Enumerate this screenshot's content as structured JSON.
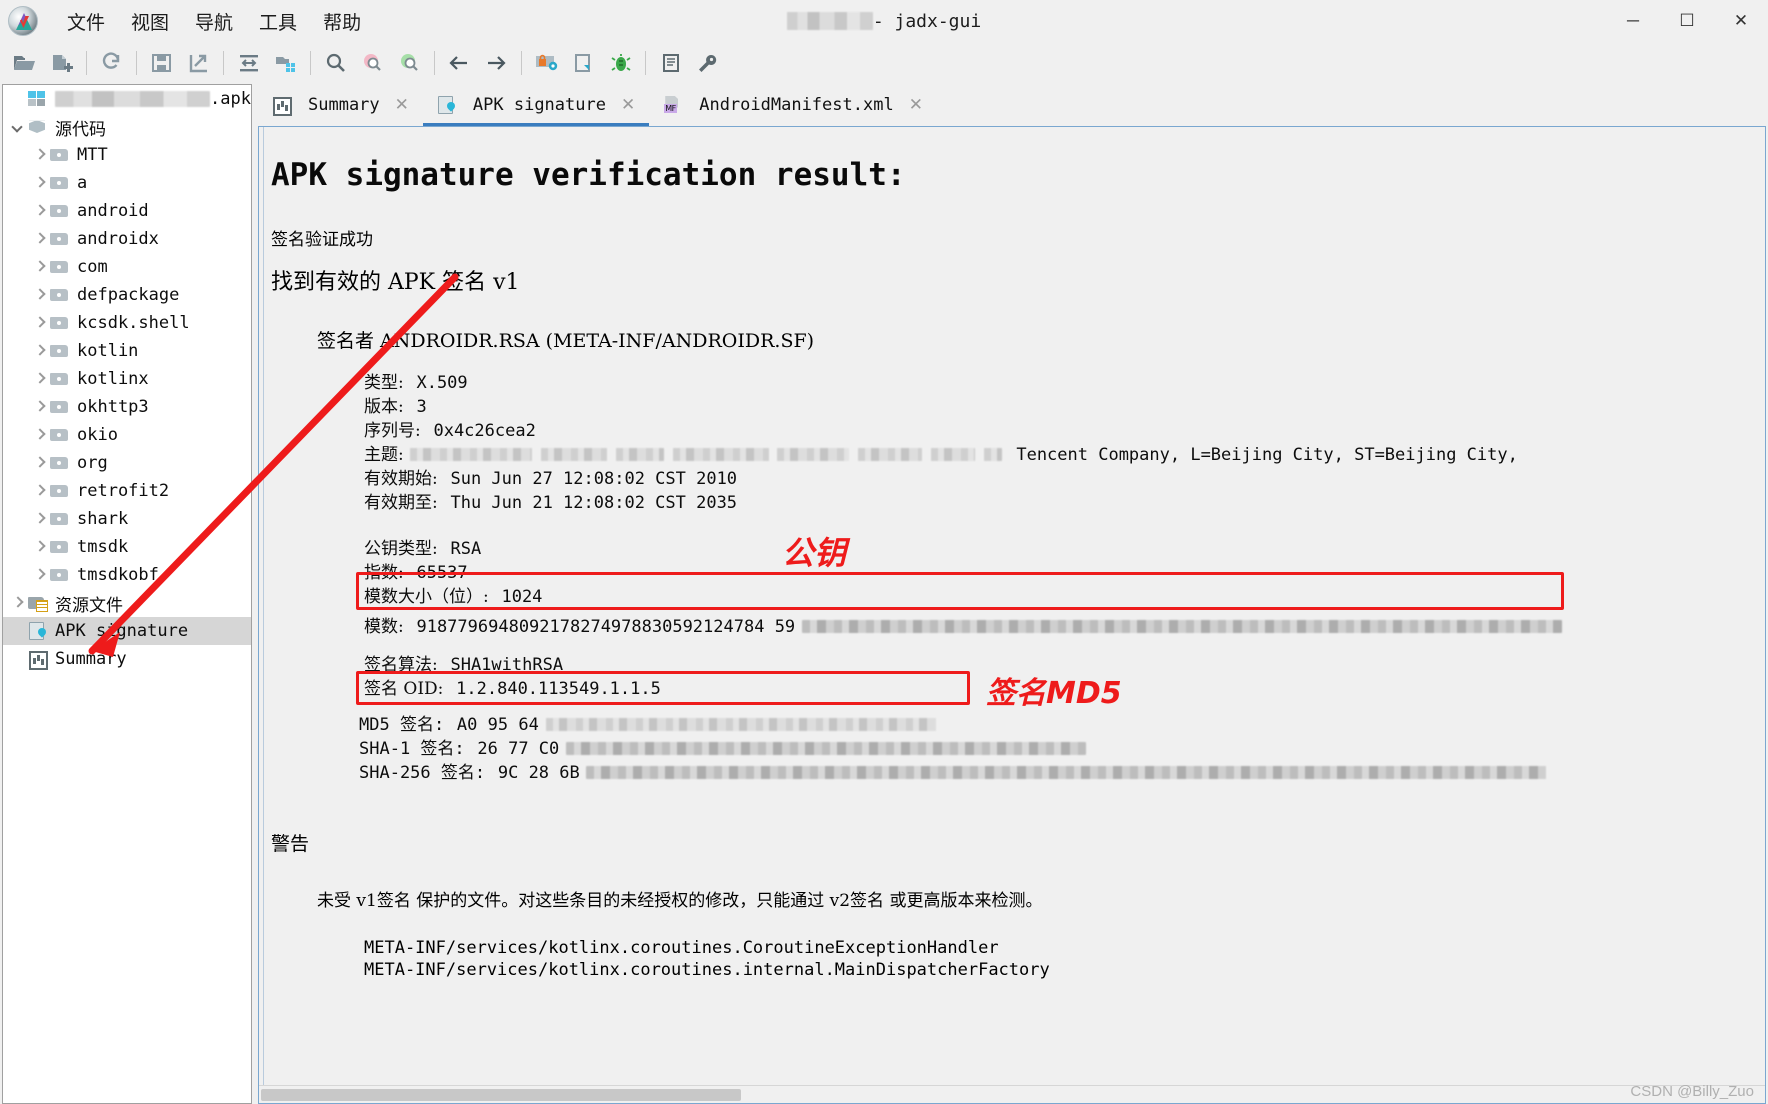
{
  "window": {
    "title_suffix": " - jadx-gui",
    "title_redacted": true,
    "minimize": "─",
    "maximize": "☐",
    "close": "✕"
  },
  "menu": [
    {
      "label": "文件",
      "name": "menu-file"
    },
    {
      "label": "视图",
      "name": "menu-view"
    },
    {
      "label": "导航",
      "name": "menu-navigation"
    },
    {
      "label": "工具",
      "name": "menu-tools"
    },
    {
      "label": "帮助",
      "name": "menu-help"
    }
  ],
  "toolbar": [
    {
      "name": "open-file-icon"
    },
    {
      "name": "add-files-icon"
    },
    {
      "name": "reload-icon"
    },
    {
      "name": "save-all-icon"
    },
    {
      "name": "export-gradle-icon"
    },
    {
      "name": "collapse-all-icon"
    },
    {
      "name": "flat-packages-icon"
    },
    {
      "name": "search-icon"
    },
    {
      "name": "search-class-icon"
    },
    {
      "name": "search-comment-icon"
    },
    {
      "name": "back-icon"
    },
    {
      "name": "forward-icon"
    },
    {
      "name": "deobfuscation-icon"
    },
    {
      "name": "decompile-icon"
    },
    {
      "name": "debug-icon"
    },
    {
      "name": "logs-icon"
    },
    {
      "name": "preferences-icon"
    }
  ],
  "sidebar": {
    "items": [
      {
        "label": ".apk",
        "icon": "apk-icon",
        "indent": 1,
        "twisty": "none",
        "redact": 175,
        "selected": false,
        "name": "tree-item-apk"
      },
      {
        "label": "源代码",
        "icon": "box-icon",
        "indent": 1,
        "twisty": "down",
        "cn": true,
        "selected": false,
        "name": "tree-item-source-code"
      },
      {
        "label": "MTT",
        "icon": "folder-icon",
        "indent": 2,
        "twisty": "right",
        "selected": false,
        "name": "tree-item-mtt"
      },
      {
        "label": "a",
        "icon": "folder-icon",
        "indent": 2,
        "twisty": "right",
        "selected": false,
        "name": "tree-item-a"
      },
      {
        "label": "android",
        "icon": "folder-icon",
        "indent": 2,
        "twisty": "right",
        "selected": false,
        "name": "tree-item-android"
      },
      {
        "label": "androidx",
        "icon": "folder-icon",
        "indent": 2,
        "twisty": "right",
        "selected": false,
        "name": "tree-item-androidx"
      },
      {
        "label": "com",
        "icon": "folder-icon",
        "indent": 2,
        "twisty": "right",
        "selected": false,
        "name": "tree-item-com"
      },
      {
        "label": "defpackage",
        "icon": "folder-icon",
        "indent": 2,
        "twisty": "right",
        "selected": false,
        "name": "tree-item-defpackage"
      },
      {
        "label": "kcsdk.shell",
        "icon": "folder-icon",
        "indent": 2,
        "twisty": "right",
        "selected": false,
        "name": "tree-item-kcsdk-shell"
      },
      {
        "label": "kotlin",
        "icon": "folder-icon",
        "indent": 2,
        "twisty": "right",
        "selected": false,
        "name": "tree-item-kotlin"
      },
      {
        "label": "kotlinx",
        "icon": "folder-icon",
        "indent": 2,
        "twisty": "right",
        "selected": false,
        "name": "tree-item-kotlinx"
      },
      {
        "label": "okhttp3",
        "icon": "folder-icon",
        "indent": 2,
        "twisty": "right",
        "selected": false,
        "name": "tree-item-okhttp3"
      },
      {
        "label": "okio",
        "icon": "folder-icon",
        "indent": 2,
        "twisty": "right",
        "selected": false,
        "name": "tree-item-okio"
      },
      {
        "label": "org",
        "icon": "folder-icon",
        "indent": 2,
        "twisty": "right",
        "selected": false,
        "name": "tree-item-org"
      },
      {
        "label": "retrofit2",
        "icon": "folder-icon",
        "indent": 2,
        "twisty": "right",
        "selected": false,
        "name": "tree-item-retrofit2"
      },
      {
        "label": "shark",
        "icon": "folder-icon",
        "indent": 2,
        "twisty": "right",
        "selected": false,
        "name": "tree-item-shark"
      },
      {
        "label": "tmsdk",
        "icon": "folder-icon",
        "indent": 2,
        "twisty": "right",
        "selected": false,
        "name": "tree-item-tmsdk"
      },
      {
        "label": "tmsdkobf",
        "icon": "folder-icon",
        "indent": 2,
        "twisty": "right",
        "selected": false,
        "name": "tree-item-tmsdkobf"
      },
      {
        "label": "资源文件",
        "icon": "resource-folder-icon",
        "indent": 1,
        "twisty": "right",
        "cn": true,
        "selected": false,
        "name": "tree-item-resources"
      },
      {
        "label": "APK signature",
        "icon": "signature-icon",
        "indent": 1,
        "twisty": "none",
        "selected": true,
        "name": "tree-item-apk-signature"
      },
      {
        "label": "Summary",
        "icon": "summary-icon",
        "indent": 1,
        "twisty": "none",
        "selected": false,
        "name": "tree-item-summary"
      }
    ]
  },
  "tabs": [
    {
      "label": "Summary",
      "icon": "summary-icon",
      "active": false,
      "closable": true,
      "name": "tab-summary"
    },
    {
      "label": "APK signature",
      "icon": "signature-icon",
      "active": true,
      "closable": true,
      "name": "tab-apk-signature"
    },
    {
      "label": "AndroidManifest.xml",
      "icon": "manifest-icon",
      "active": false,
      "closable": true,
      "name": "tab-android-manifest"
    }
  ],
  "report": {
    "title": "APK signature verification result:",
    "verify_ok": "签名验证成功",
    "found_valid": "找到有效的 APK 签名 v1",
    "signer": "签名者 ANDROIDR.RSA (META-INF/ANDROIDR.SF)",
    "fields": {
      "type_label": "类型:",
      "type_value": "X.509",
      "version_label": "版本:",
      "version_value": "3",
      "serial_label": "序列号:",
      "serial_value": "0x4c26cea2",
      "subject_label": "主题:",
      "subject_visible_tail": "Tencent Company, L=Beijing City, ST=Beijing City,",
      "valid_from_label": "有效期始:",
      "valid_from_value": "Sun Jun 27 12:08:02 CST 2010",
      "valid_to_label": "有效期至:",
      "valid_to_value": "Thu Jun 21 12:08:02 CST 2035",
      "pubkey_type_label": "公钥类型:",
      "pubkey_type_value": "RSA",
      "exponent_label": "指数:",
      "exponent_value": "65537",
      "modulus_size_label": "模数大小（位）:",
      "modulus_size_value": "1024",
      "modulus_label": "模数:",
      "modulus_visible": "9187796948092178274978830592124784 59",
      "sig_algo_label": "签名算法:",
      "sig_algo_value": "SHA1withRSA",
      "sig_oid_label": "签名 OID:",
      "sig_oid_value": "1.2.840.113549.1.1.5",
      "md5_label": "MD5 签名:",
      "md5_visible": "A0 95 64",
      "sha1_label": "SHA-1 签名:",
      "sha1_visible": "26 77 C0",
      "sha256_label": "SHA-256 签名:",
      "sha256_visible": "9C 28 6B"
    },
    "warning_title": "警告",
    "warning_body": "未受 v1签名 保护的文件。对这些条目的未经授权的修改，只能通过 v2签名 或更高版本来检测。",
    "warning_files": [
      "META-INF/services/kotlinx.coroutines.CoroutineExceptionHandler",
      "META-INF/services/kotlinx.coroutines.internal.MainDispatcherFactory"
    ]
  },
  "annotations": {
    "public_key_label": "公钥",
    "md5_label": "签名MD5",
    "color": "#ee1b1b"
  },
  "watermark": "CSDN @Billy_Zuo",
  "colors": {
    "accent": "#3a7dbf",
    "selection": "#d6d6d6",
    "annotation_red": "#ee1b1b",
    "window_bg": "#f0f0f0"
  }
}
